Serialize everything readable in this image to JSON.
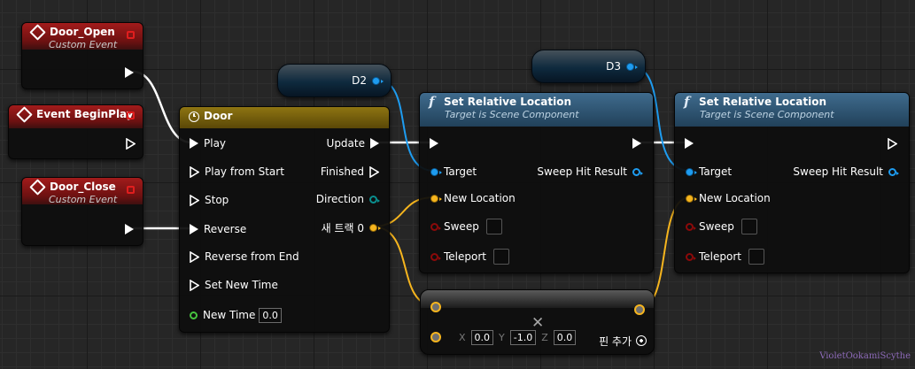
{
  "colors": {
    "exec_wire": "#ffffff",
    "object_wire": "#1e9cf0",
    "vector_wire": "#f6b51e",
    "event_header": "#a21b1b",
    "timeline_header": "#8e7512",
    "function_header": "#3f6b8d"
  },
  "nodes": {
    "door_open": {
      "title": "Door_Open",
      "subtitle": "Custom Event",
      "icon": "diamond-icon"
    },
    "begin_play": {
      "title": "Event BeginPlay",
      "icon": "diamond-icon"
    },
    "door_close": {
      "title": "Door_Close",
      "subtitle": "Custom Event",
      "icon": "diamond-icon"
    },
    "door_timeline": {
      "title": "Door",
      "icon": "clock-icon",
      "inputs": [
        "Play",
        "Play from Start",
        "Stop",
        "Reverse",
        "Reverse from End",
        "Set New Time"
      ],
      "new_time_label": "New Time",
      "new_time_value": "0.0",
      "outputs": [
        "Update",
        "Finished",
        "Direction",
        "새 트랙 0"
      ]
    },
    "d2": {
      "label": "D2"
    },
    "d3": {
      "label": "D3"
    },
    "set_loc_1": {
      "title": "Set Relative Location",
      "subtitle": "Target is Scene Component",
      "icon": "function-icon",
      "target": "Target",
      "new_location": "New Location",
      "sweep": "Sweep",
      "teleport": "Teleport",
      "sweep_hit": "Sweep Hit Result"
    },
    "set_loc_2": {
      "title": "Set Relative Location",
      "subtitle": "Target is Scene Component",
      "icon": "function-icon",
      "target": "Target",
      "new_location": "New Location",
      "sweep": "Sweep",
      "teleport": "Teleport",
      "sweep_hit": "Sweep Hit Result"
    },
    "make_vector": {
      "x_label": "X",
      "x_value": "0.0",
      "y_label": "Y",
      "y_value": "-1.0",
      "z_label": "Z",
      "z_value": "0.0",
      "add_pin": "핀 추가"
    }
  },
  "watermark": "VioletOokamiScythe"
}
